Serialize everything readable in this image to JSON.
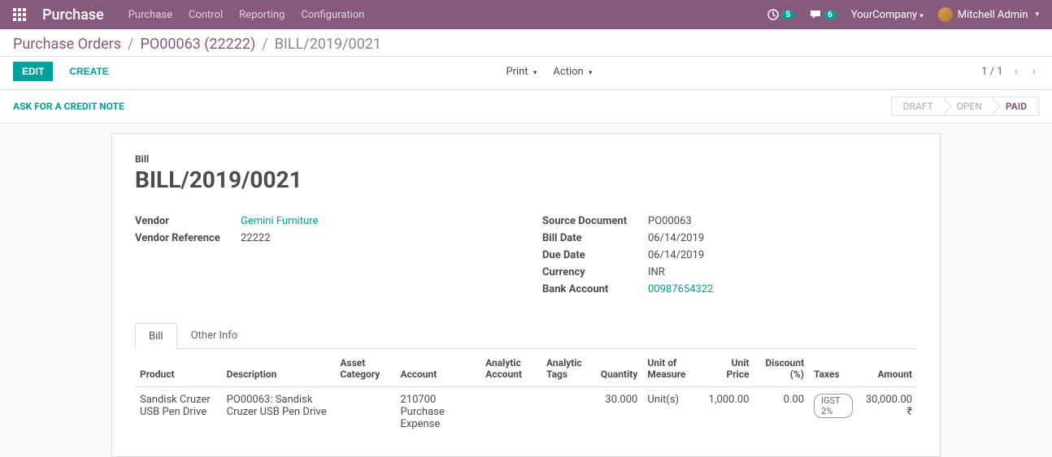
{
  "topbar": {
    "brand": "Purchase",
    "nav": [
      "Purchase",
      "Control",
      "Reporting",
      "Configuration"
    ],
    "clock_badge": "5",
    "chat_badge": "6",
    "company": "YourCompany",
    "user": "Mitchell Admin"
  },
  "breadcrumb": {
    "root": "Purchase Orders",
    "po": "PO00063 (22222)",
    "current": "BILL/2019/0021"
  },
  "toolbar": {
    "edit": "EDIT",
    "create": "CREATE",
    "print": "Print",
    "action": "Action",
    "pager": "1 / 1"
  },
  "statusbar": {
    "credit_note": "ASK FOR A CREDIT NOTE",
    "steps": [
      "DRAFT",
      "OPEN",
      "PAID"
    ]
  },
  "bill": {
    "label": "Bill",
    "number": "BILL/2019/0021",
    "left": {
      "vendor_label": "Vendor",
      "vendor": "Gemini Furniture",
      "vendor_ref_label": "Vendor Reference",
      "vendor_ref": "22222"
    },
    "right": {
      "source_label": "Source Document",
      "source": "PO00063",
      "bill_date_label": "Bill Date",
      "bill_date": "06/14/2019",
      "due_date_label": "Due Date",
      "due_date": "06/14/2019",
      "currency_label": "Currency",
      "currency": "INR",
      "bank_label": "Bank Account",
      "bank": "00987654322"
    }
  },
  "tabs": {
    "bill": "Bill",
    "other": "Other Info"
  },
  "cols": {
    "product": "Product",
    "description": "Description",
    "asset": "Asset Category",
    "account": "Account",
    "analytic_account": "Analytic Account",
    "analytic_tags": "Analytic Tags",
    "quantity": "Quantity",
    "uom": "Unit of Measure",
    "unit_price": "Unit Price",
    "discount": "Discount (%)",
    "taxes": "Taxes",
    "amount": "Amount"
  },
  "line": {
    "product": "Sandisk Cruzer USB Pen Drive",
    "description": "PO00063: Sandisk Cruzer USB Pen Drive",
    "asset": "",
    "account": "210700 Purchase Expense",
    "analytic_account": "",
    "analytic_tags": "",
    "quantity": "30.000",
    "uom": "Unit(s)",
    "unit_price": "1,000.00",
    "discount": "0.00",
    "taxes": "IGST 2%",
    "amount": "30,000.00 ₹"
  }
}
